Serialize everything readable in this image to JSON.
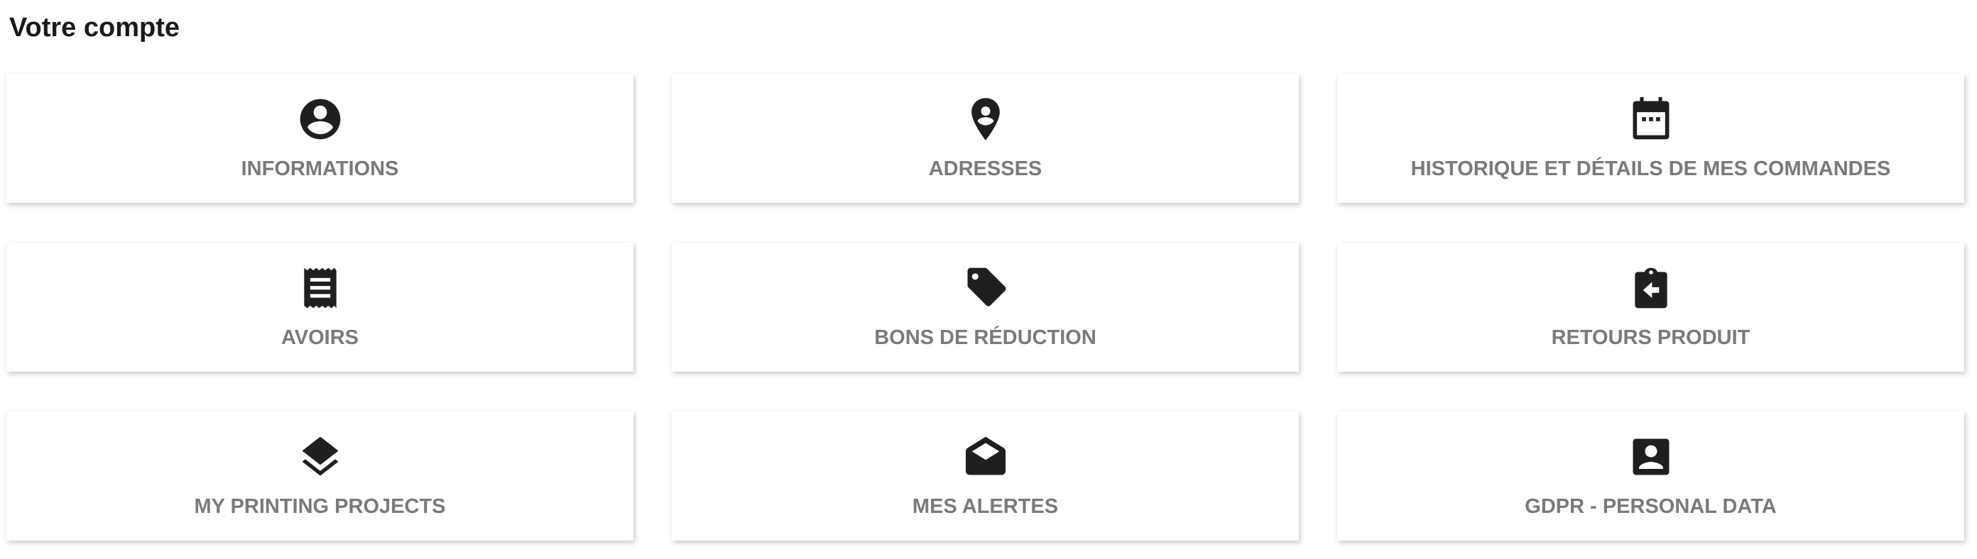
{
  "page": {
    "title": "Votre compte"
  },
  "colors": {
    "icon": "#1f1f1f",
    "label": "#7a7a7a",
    "card_background": "#ffffff"
  },
  "cards": [
    {
      "label": "INFORMATIONS",
      "icon": "account-circle-icon"
    },
    {
      "label": "ADRESSES",
      "icon": "location-pin-icon"
    },
    {
      "label": "HISTORIQUE ET DÉTAILS DE MES COMMANDES",
      "icon": "calendar-icon"
    },
    {
      "label": "AVOIRS",
      "icon": "receipt-icon"
    },
    {
      "label": "BONS DE RÉDUCTION",
      "icon": "tag-icon"
    },
    {
      "label": "RETOURS PRODUIT",
      "icon": "clipboard-return-icon"
    },
    {
      "label": "MY PRINTING PROJECTS",
      "icon": "layers-icon"
    },
    {
      "label": "MES ALERTES",
      "icon": "open-envelope-icon"
    },
    {
      "label": "GDPR - PERSONAL DATA",
      "icon": "account-box-icon"
    }
  ]
}
